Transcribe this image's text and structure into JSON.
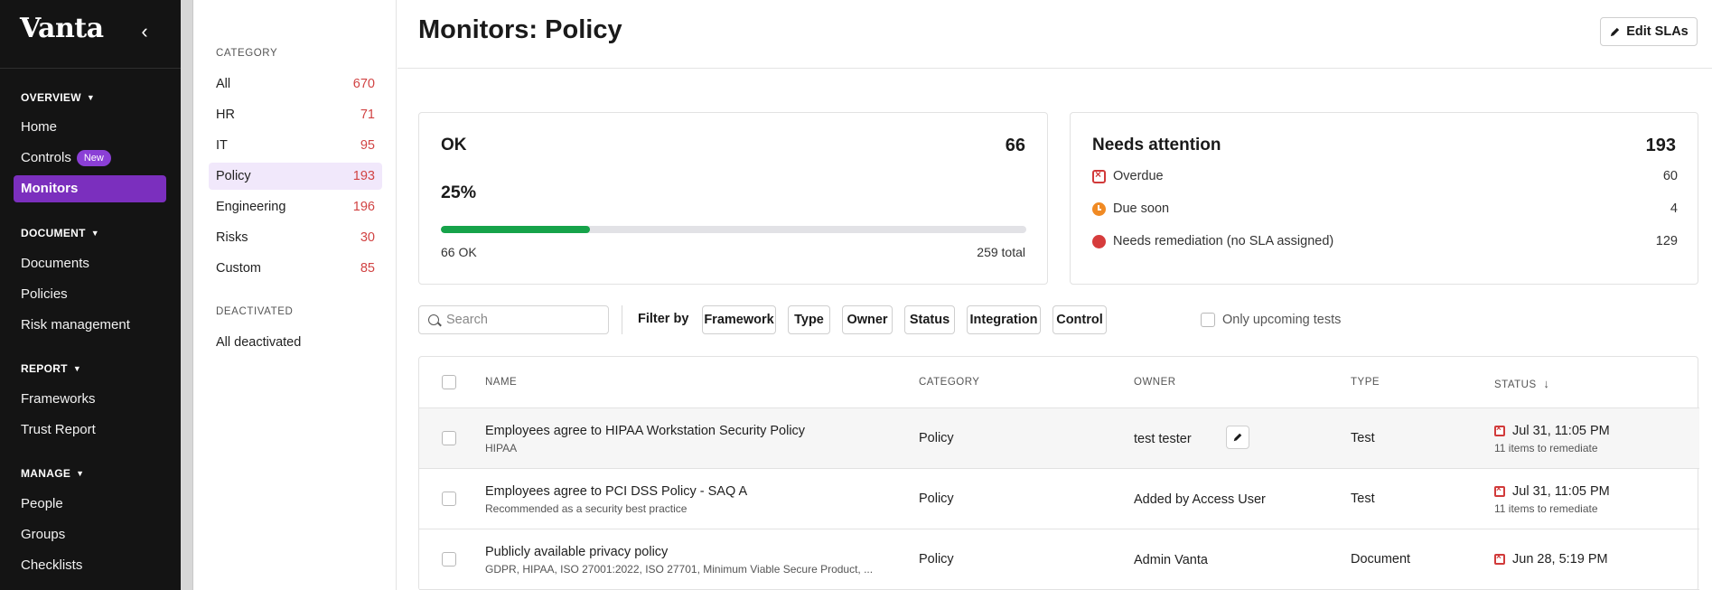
{
  "sidebar": {
    "logo": "Vanta",
    "collapse_glyph": "‹",
    "sections": [
      {
        "label": "OVERVIEW",
        "items": [
          {
            "label": "Home"
          },
          {
            "label": "Controls",
            "badge": "New"
          },
          {
            "label": "Monitors",
            "active": true
          }
        ]
      },
      {
        "label": "DOCUMENT",
        "items": [
          {
            "label": "Documents"
          },
          {
            "label": "Policies"
          },
          {
            "label": "Risk management"
          }
        ]
      },
      {
        "label": "REPORT",
        "items": [
          {
            "label": "Frameworks"
          },
          {
            "label": "Trust Report"
          }
        ]
      },
      {
        "label": "MANAGE",
        "items": [
          {
            "label": "People"
          },
          {
            "label": "Groups"
          },
          {
            "label": "Checklists"
          }
        ]
      }
    ]
  },
  "categories": {
    "heading": "CATEGORY",
    "items": [
      {
        "label": "All",
        "count": "670"
      },
      {
        "label": "HR",
        "count": "71"
      },
      {
        "label": "IT",
        "count": "95"
      },
      {
        "label": "Policy",
        "count": "193",
        "active": true
      },
      {
        "label": "Engineering",
        "count": "196"
      },
      {
        "label": "Risks",
        "count": "30"
      },
      {
        "label": "Custom",
        "count": "85"
      }
    ],
    "deactivated_heading": "DEACTIVATED",
    "deactivated_item": "All deactivated"
  },
  "header": {
    "title": "Monitors: Policy",
    "edit_slas_label": "Edit SLAs"
  },
  "ok_card": {
    "title": "OK",
    "count": "66",
    "percent_label": "25%",
    "progress_fraction": 0.255,
    "ok_label": "66 OK",
    "total_label": "259 total"
  },
  "attention_card": {
    "title": "Needs attention",
    "count": "193",
    "rows": [
      {
        "icon": "calendar-x-icon",
        "label": "Overdue",
        "value": "60"
      },
      {
        "icon": "clock-icon",
        "label": "Due soon",
        "value": "4"
      },
      {
        "icon": "red-dot-icon",
        "label": "Needs remediation (no SLA assigned)",
        "value": "129"
      }
    ]
  },
  "filters": {
    "search_placeholder": "Search",
    "filter_by_label": "Filter by",
    "chips": [
      "Framework",
      "Type",
      "Owner",
      "Status",
      "Integration",
      "Control"
    ],
    "upcoming_label": "Only upcoming tests"
  },
  "table": {
    "columns": {
      "name": "NAME",
      "category": "CATEGORY",
      "owner": "OWNER",
      "type": "TYPE",
      "status": "STATUS",
      "sort_glyph": "↓"
    },
    "rows": [
      {
        "name": "Employees agree to HIPAA Workstation Security Policy",
        "frameworks": "HIPAA",
        "category": "Policy",
        "owner": "test tester",
        "type": "Test",
        "status": "Jul 31, 11:05 PM",
        "status_sub": "11 items to remediate"
      },
      {
        "name": "Employees agree to PCI DSS Policy - SAQ A",
        "frameworks": "Recommended as a security best practice",
        "category": "Policy",
        "owner": "Added by Access User",
        "type": "Test",
        "status": "Jul 31, 11:05 PM",
        "status_sub": "11 items to remediate"
      },
      {
        "name": "Publicly available privacy policy",
        "frameworks": "GDPR, HIPAA, ISO 27001:2022, ISO 27701, Minimum Viable Secure Product, ...",
        "category": "Policy",
        "owner": "Admin Vanta",
        "type": "Document",
        "status": "Jun 28, 5:19 PM",
        "status_sub": ""
      }
    ]
  },
  "colors": {
    "accent": "#7b2fbe",
    "progress": "#16a34a",
    "count_red": "#d14343"
  }
}
